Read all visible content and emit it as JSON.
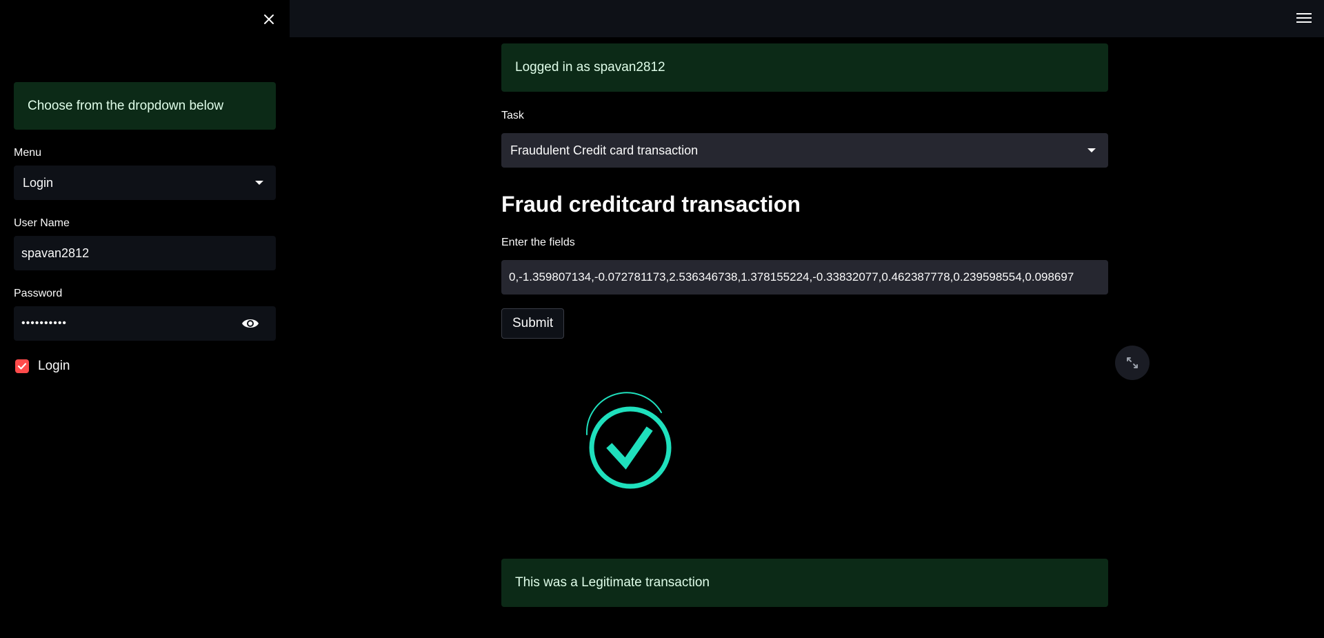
{
  "sidebar": {
    "info": "Choose from the dropdown below",
    "menu_label": "Menu",
    "menu_value": "Login",
    "username_label": "User Name",
    "username_value": "spavan2812",
    "password_label": "Password",
    "password_value": "••••••••••",
    "login_checkbox_label": "Login",
    "login_checked": true
  },
  "main": {
    "logged_in_message": "Logged in as spavan2812",
    "task_label": "Task",
    "task_value": "Fraudulent Credit card transaction",
    "title": "Fraud creditcard transaction",
    "fields_label": "Enter the fields",
    "fields_value": "0,-1.359807134,-0.072781173,2.536346738,1.378155224,-0.33832077,0.462387778,0.239598554,0.098697",
    "submit_label": "Submit",
    "result_message": "This was a Legitimate transaction"
  },
  "icons": {
    "close": "close-icon",
    "hamburger": "hamburger-menu-icon",
    "eye": "eye-icon",
    "fullscreen": "fullscreen-icon",
    "success": "success-check-icon"
  },
  "colors": {
    "success_bg": "#0c2a17",
    "success_text": "#dffde9",
    "accent": "#ff4b4b",
    "check_animation": "#1fe0bd"
  }
}
